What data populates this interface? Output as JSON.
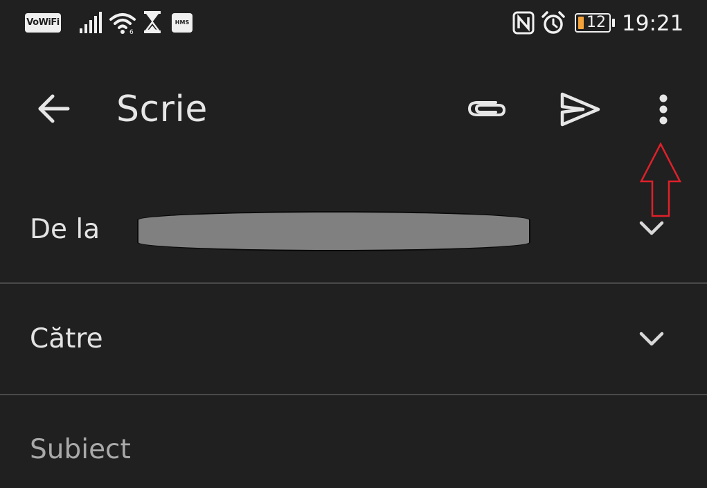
{
  "status_bar": {
    "vowifi_label": "VoWiFi",
    "hms_label": "HMS",
    "battery_level": "12",
    "time": "19:21",
    "icons": [
      "signal-icon",
      "wifi-icon",
      "hourglass-icon",
      "nfc-icon",
      "alarm-icon",
      "battery-icon"
    ],
    "battery_color": "#f3a23a"
  },
  "app_bar": {
    "title": "Scrie",
    "icons": [
      "back-arrow-icon",
      "attach-icon",
      "send-icon",
      "more-vert-icon"
    ]
  },
  "compose": {
    "from_label": "De la",
    "to_label": "Către",
    "subject_placeholder": "Subiect"
  },
  "annotation": {
    "arrow_color": "#e0202a",
    "target": "more-vert-icon"
  }
}
